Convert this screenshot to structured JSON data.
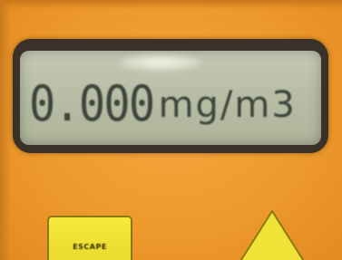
{
  "display": {
    "value": "0.000",
    "unit": "mg/m3"
  },
  "buttons": {
    "escape_label": "ESCAPE",
    "up_icon": "triangle-up-icon"
  },
  "colors": {
    "housing": "#ee9a2d",
    "lcd_background": "#b8bea6",
    "lcd_segments": "#3f443b",
    "button_yellow": "#f0e338"
  }
}
